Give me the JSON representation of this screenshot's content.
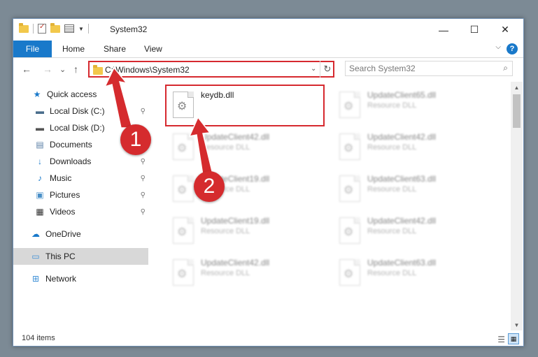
{
  "window": {
    "title": "System32",
    "controls": {
      "minimize": "—",
      "maximize": "☐",
      "close": "✕"
    }
  },
  "ribbon": {
    "tabs": [
      "File",
      "Home",
      "Share",
      "View"
    ],
    "help": "?",
    "collapse": "⌵"
  },
  "nav": {
    "back": "←",
    "forward": "→",
    "recent": "⌄",
    "up": "↑",
    "address": "C:\\Windows\\System32",
    "address_dropdown": "⌄",
    "refresh": "↻",
    "search_placeholder": "Search System32",
    "search_icon": "⌕"
  },
  "sidebar": {
    "items": [
      {
        "label": "Quick access",
        "icon": "star-icon",
        "glyph": "★",
        "color": "#1979ca",
        "pinned": false
      },
      {
        "label": "Local Disk (C:)",
        "icon": "drive-icon",
        "glyph": "▬",
        "color": "#4a6d8c",
        "pinned": true
      },
      {
        "label": "Local Disk (D:)",
        "icon": "drive-icon",
        "glyph": "▬",
        "color": "#555555",
        "pinned": false
      },
      {
        "label": "Documents",
        "icon": "documents-icon",
        "glyph": "▤",
        "color": "#5b7fa6",
        "pinned": false
      },
      {
        "label": "Downloads",
        "icon": "download-icon",
        "glyph": "↓",
        "color": "#1979ca",
        "pinned": true
      },
      {
        "label": "Music",
        "icon": "music-icon",
        "glyph": "♪",
        "color": "#1979ca",
        "pinned": true
      },
      {
        "label": "Pictures",
        "icon": "pictures-icon",
        "glyph": "▣",
        "color": "#4a90c8",
        "pinned": true
      },
      {
        "label": "Videos",
        "icon": "videos-icon",
        "glyph": "▦",
        "color": "#333333",
        "pinned": true
      },
      {
        "label": "OneDrive",
        "icon": "cloud-icon",
        "glyph": "☁",
        "color": "#1979ca",
        "pinned": false
      },
      {
        "label": "This PC",
        "icon": "computer-icon",
        "glyph": "▭",
        "color": "#3a8ed6",
        "pinned": false,
        "selected": true
      },
      {
        "label": "Network",
        "icon": "network-icon",
        "glyph": "⊞",
        "color": "#3a8ed6",
        "pinned": false
      }
    ],
    "pin_glyph": "📌"
  },
  "files": [
    {
      "name": "keydb.dll",
      "type": "",
      "highlight": true
    },
    {
      "name": "UpdateClient65.dll",
      "type": "Resource DLL"
    },
    {
      "name": "UpdateClient42.dll",
      "type": "Resource DLL"
    },
    {
      "name": "UpdateClient42.dll",
      "type": "Resource DLL"
    },
    {
      "name": "UpdateClient19.dll",
      "type": "Resource DLL"
    },
    {
      "name": "UpdateClient63.dll",
      "type": "Resource DLL"
    },
    {
      "name": "UpdateClient19.dll",
      "type": "Resource DLL"
    },
    {
      "name": "UpdateClient42.dll",
      "type": "Resource DLL"
    },
    {
      "name": "UpdateClient42.dll",
      "type": "Resource DLL"
    },
    {
      "name": "UpdateClient63.dll",
      "type": "Resource DLL"
    }
  ],
  "status": {
    "count": "104 items"
  },
  "annotations": {
    "step1": "1",
    "step2": "2",
    "color": "#d52b2e"
  }
}
